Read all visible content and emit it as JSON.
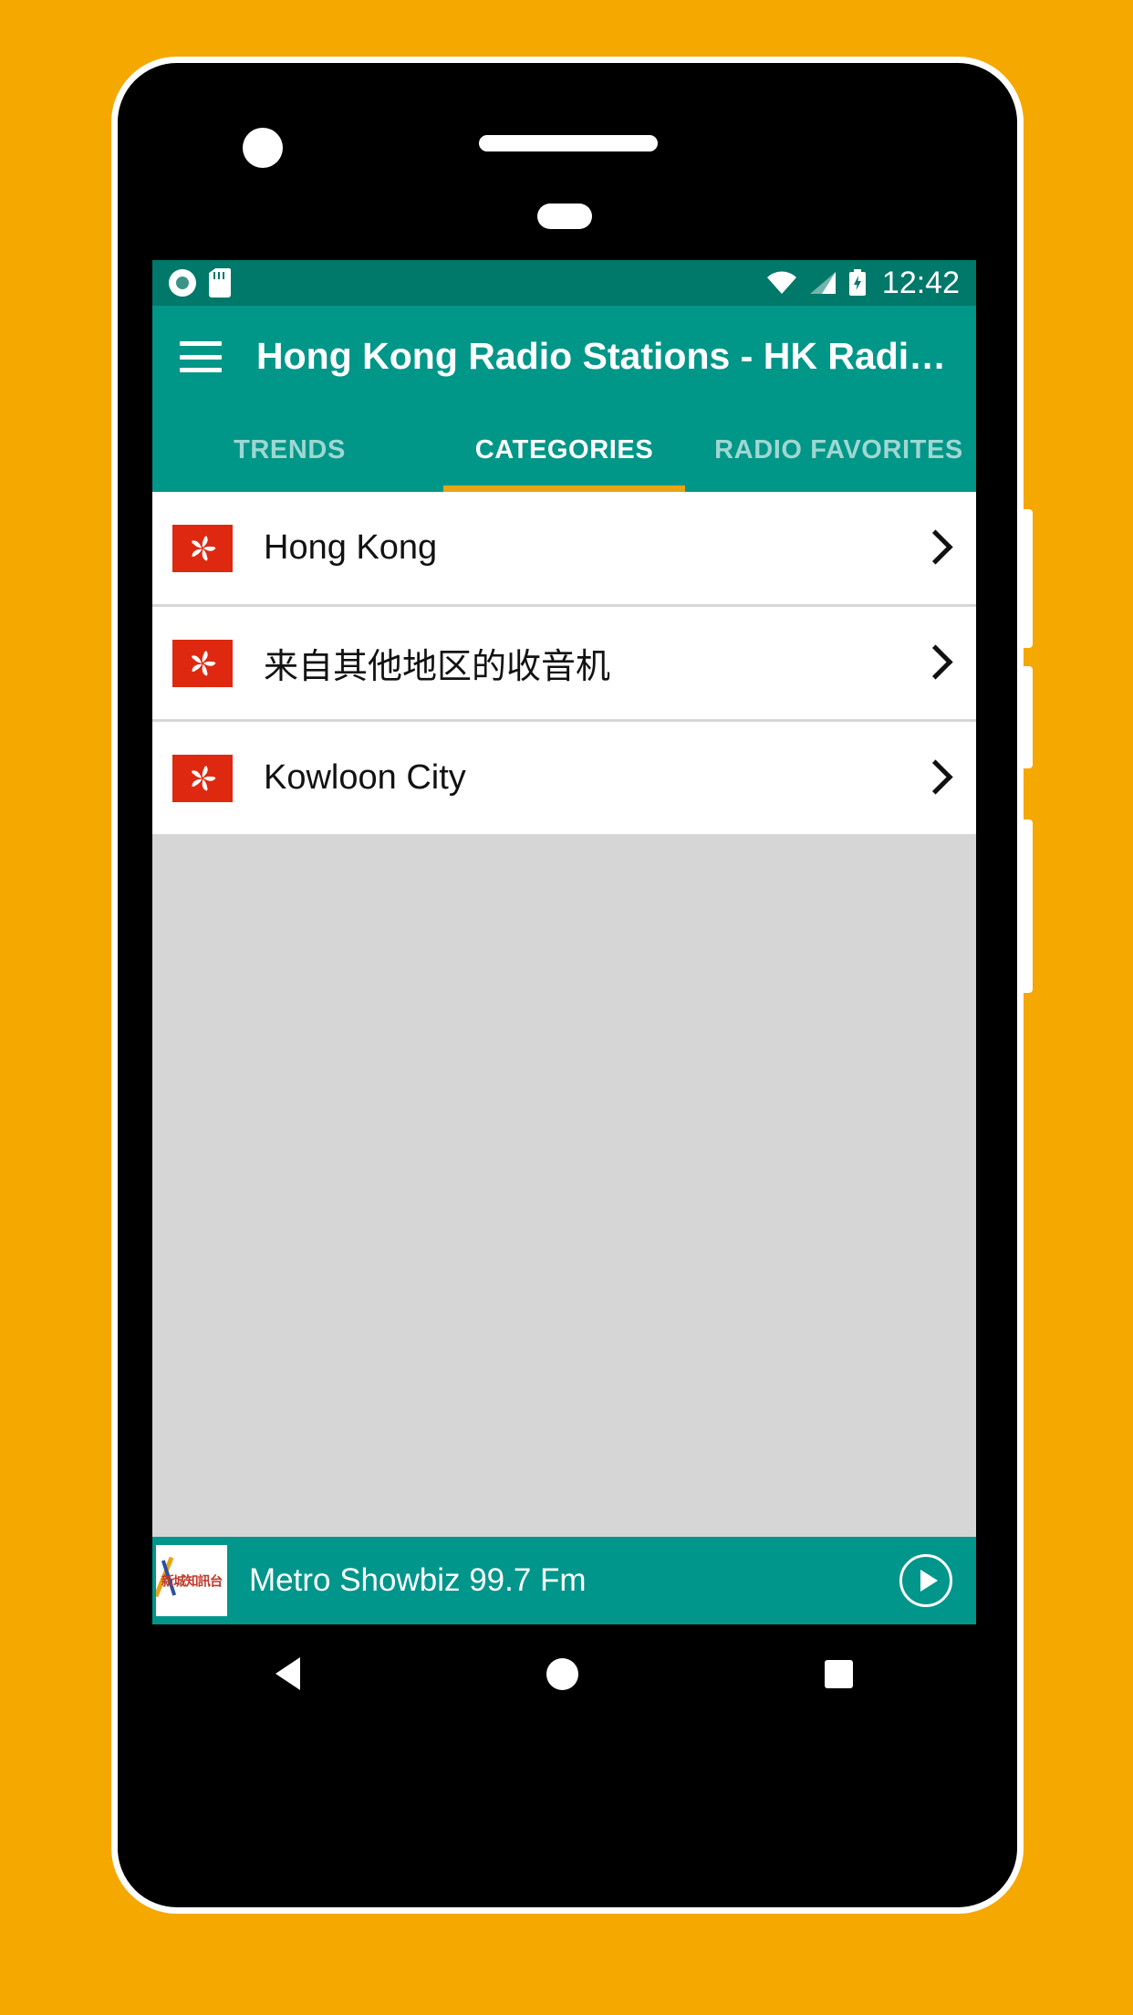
{
  "theme": {
    "background": "#F5A800",
    "primary": "#009688",
    "primary_dark": "#00786A",
    "accent": "#E8A317",
    "flag_red": "#DE2910"
  },
  "status_bar": {
    "time": "12:42",
    "left_icons": [
      "recording-dot-icon",
      "sd-card-icon"
    ],
    "right_icons": [
      "wifi-icon",
      "cellular-signal-icon",
      "battery-charging-icon"
    ]
  },
  "app_bar": {
    "menu_icon": "hamburger-menu-icon",
    "title": "Hong Kong Radio Stations - HK Radi…"
  },
  "tabs": [
    {
      "label": "TRENDS",
      "active": false
    },
    {
      "label": "CATEGORIES",
      "active": true
    },
    {
      "label": "RADIO FAVORITES",
      "active": false
    }
  ],
  "categories": [
    {
      "label": "Hong Kong",
      "icon": "hong-kong-flag-icon",
      "chevron": "chevron-right-icon"
    },
    {
      "label": "来自其他地区的收音机",
      "icon": "hong-kong-flag-icon",
      "chevron": "chevron-right-icon"
    },
    {
      "label": "Kowloon City",
      "icon": "hong-kong-flag-icon",
      "chevron": "chevron-right-icon"
    }
  ],
  "player": {
    "station_name": "Metro Showbiz 99.7 Fm",
    "thumbnail_text": "新城知訊台",
    "play_icon": "play-circle-icon"
  },
  "nav_bar": {
    "back": "back-triangle-icon",
    "home": "home-circle-icon",
    "recents": "recents-square-icon"
  }
}
